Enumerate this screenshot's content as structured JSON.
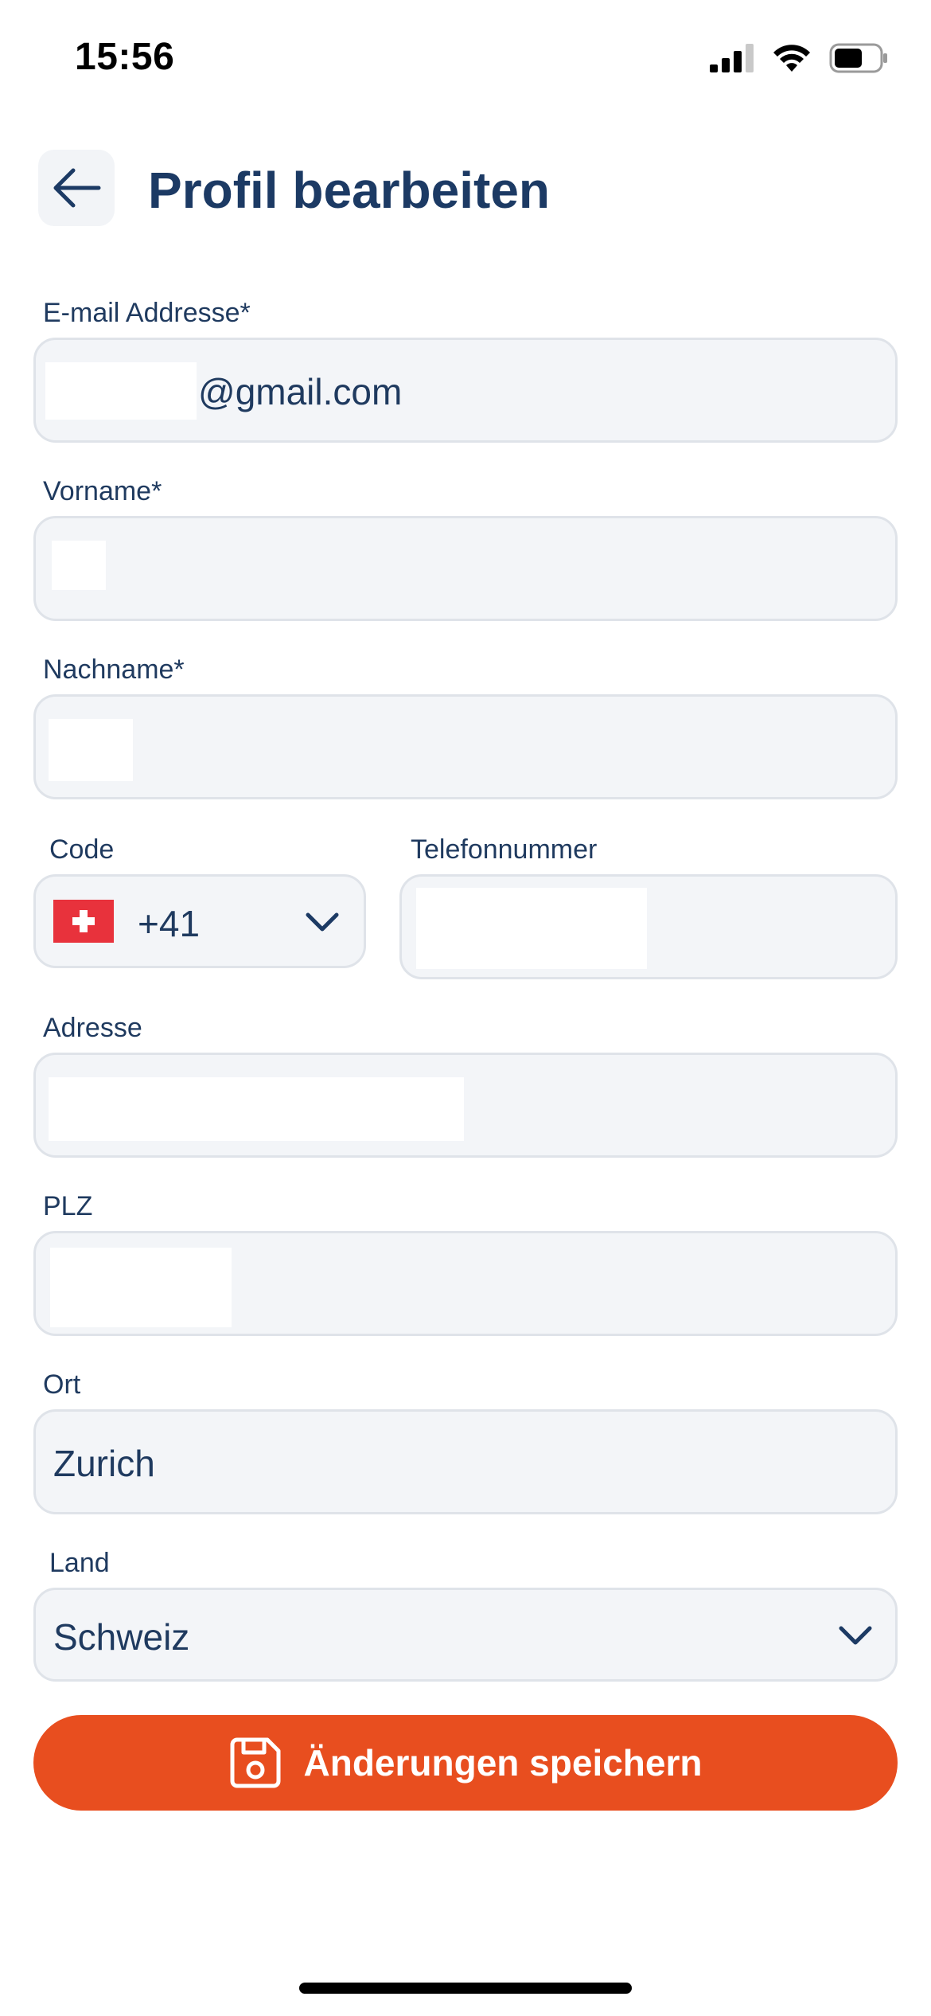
{
  "status_bar": {
    "time": "15:56",
    "icons": [
      "cellular-signal-icon",
      "wifi-icon",
      "battery-icon"
    ]
  },
  "header": {
    "back_icon": "arrow-left-icon",
    "title": "Profil bearbeiten"
  },
  "form": {
    "email": {
      "label": "E-mail Addresse*",
      "value_visible": "@gmail.com"
    },
    "first_name": {
      "label": "Vorname*"
    },
    "last_name": {
      "label": "Nachname*"
    },
    "phone_code": {
      "label": "Code",
      "value": "+41",
      "flag": "switzerland-flag-icon"
    },
    "phone_number": {
      "label": "Telefonnummer"
    },
    "address": {
      "label": "Adresse"
    },
    "zip": {
      "label": "PLZ"
    },
    "city": {
      "label": "Ort",
      "value": "Zurich"
    },
    "country": {
      "label": "Land",
      "value": "Schweiz"
    }
  },
  "save_button": {
    "label": "Änderungen speichern",
    "icon": "save-disk-icon"
  },
  "colors": {
    "primary_text": "#1c3a64",
    "accent": "#e84e1f",
    "field_bg": "#f3f5f8",
    "field_border": "#dfe3e9"
  }
}
